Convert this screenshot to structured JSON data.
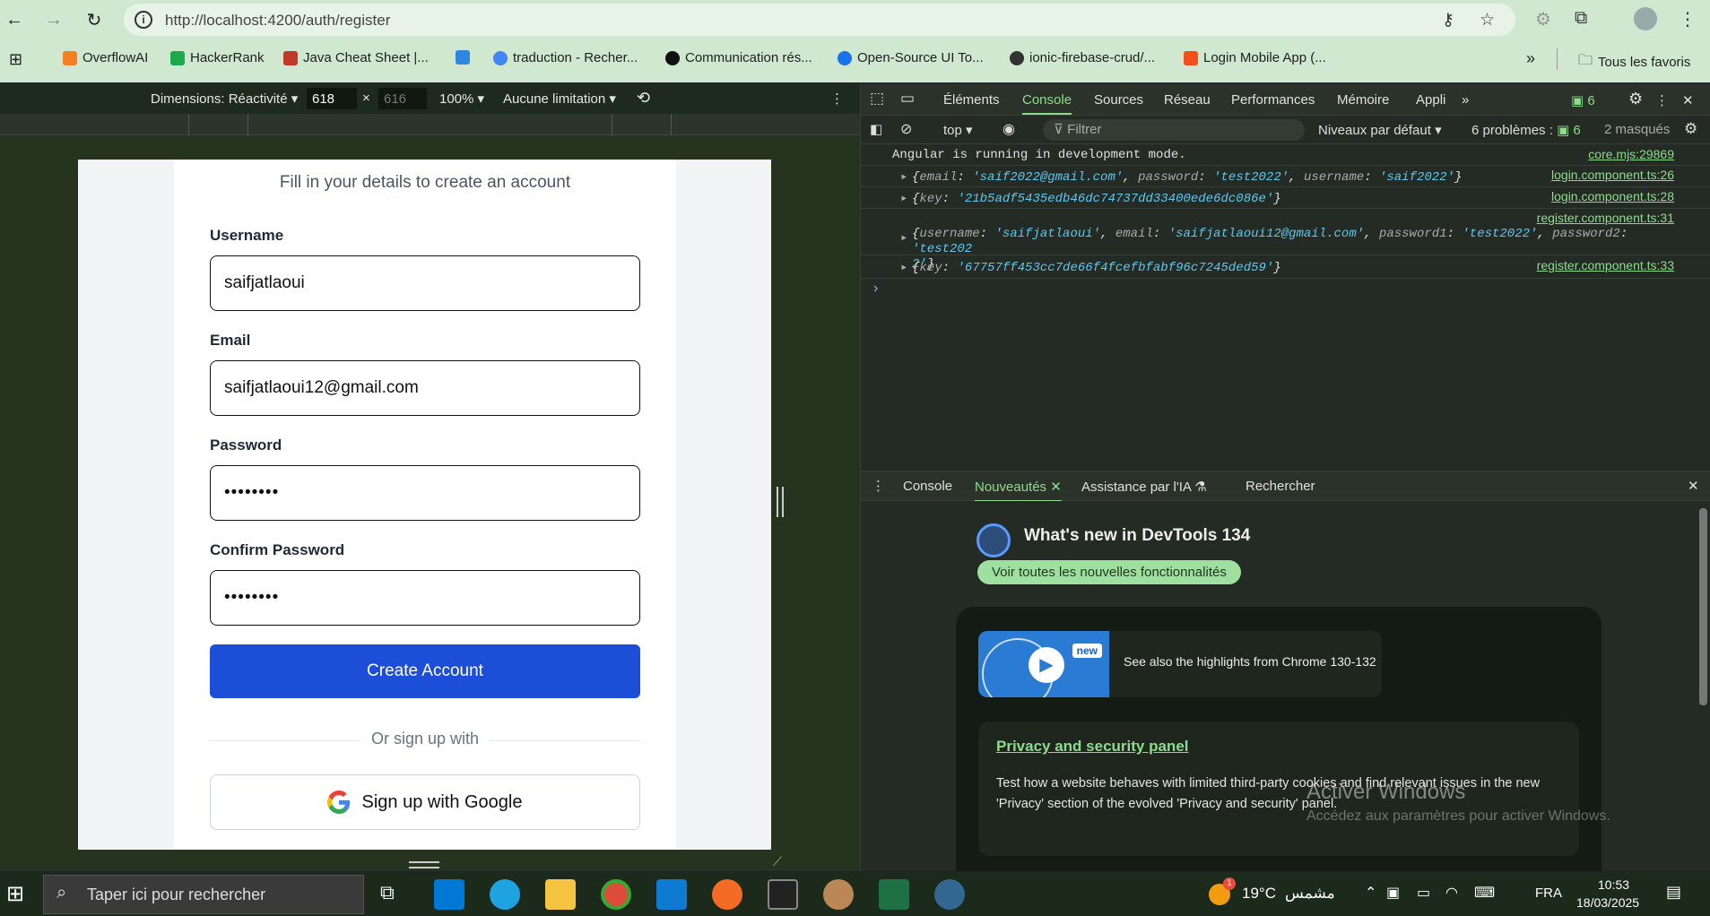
{
  "browser": {
    "url": "http://localhost:4200/auth/register",
    "bookmarks": [
      {
        "label": "OverflowAI",
        "color": "#f48024"
      },
      {
        "label": "HackerRank",
        "color": "#1ba94c"
      },
      {
        "label": "Java Cheat Sheet |...",
        "color": "#c0392b"
      },
      {
        "label": "",
        "color": "#2e86de"
      },
      {
        "label": "traduction - Recher...",
        "color": "#4285f4"
      },
      {
        "label": "Communication rés...",
        "color": "#111111"
      },
      {
        "label": "Open-Source UI To...",
        "color": "#1a73e8"
      },
      {
        "label": "ionic-firebase-crud/...",
        "color": "#333333"
      },
      {
        "label": "Login Mobile App (...",
        "color": "#f24e1e"
      }
    ],
    "more_bookmarks": "»",
    "all_favorites": "Tous les favoris"
  },
  "device_toolbar": {
    "dimensions_label": "Dimensions: Réactivité ▾",
    "width": "618",
    "height": "616",
    "zoom": "100% ▾",
    "throttle": "Aucune limitation ▾",
    "more": "⋮"
  },
  "form": {
    "subtitle": "Fill in your details to create an account",
    "username_label": "Username",
    "username_value": "saifjatlaoui",
    "email_label": "Email",
    "email_value": "saifjatlaoui12@gmail.com",
    "password_label": "Password",
    "password_value": "••••••••",
    "confirm_label": "Confirm Password",
    "confirm_value": "••••••••",
    "create_button": "Create Account",
    "divider": "Or sign up with",
    "google_button": "Sign up with Google"
  },
  "devtools": {
    "tabs": [
      "Éléments",
      "Console",
      "Sources",
      "Réseau",
      "Performances",
      "Mémoire",
      "Appli"
    ],
    "active_tab": "Console",
    "issues_count": "6",
    "context": "top ▾",
    "filter_placeholder": "Filtrer",
    "levels": "Niveaux par défaut ▾",
    "problems": "6 problèmes :",
    "problems_count": "6",
    "hidden": "2 masqués",
    "logs": [
      {
        "text": "Angular is running in development mode.",
        "source": "core.mjs:29869"
      },
      {
        "source": "login.component.ts:26"
      },
      {
        "source": "login.component.ts:28"
      },
      {
        "source": "register.component.ts:31"
      },
      {
        "source": "register.component.ts:33"
      }
    ],
    "log1": {
      "email_key": "email",
      "email_val": "'saif2022@gmail.com'",
      "password_key": "password",
      "password_val": "'test2022'",
      "username_key": "username",
      "username_val": "'saif2022'"
    },
    "log2": {
      "key": "key",
      "val": "'21b5adf5435edb46dc74737dd33400ede6dc086e'"
    },
    "log3": {
      "username_key": "username",
      "username_val": "'saifjatlaoui'",
      "email_key": "email",
      "email_val": "'saifjatlaoui12@gmail.com'",
      "p1_key": "password1",
      "p1_val": "'test2022'",
      "p2_key": "password2",
      "p2_val_a": "'test202",
      "p2_val_b": "2'"
    },
    "log4": {
      "key": "key",
      "val": "'67757ff453cc7de66f4fcefbfabf96c7245ded59'"
    },
    "drawer_tabs": [
      "Console",
      "Nouveautés",
      "Assistance par l'IA",
      "Rechercher"
    ],
    "whats_new_title": "What's new in DevTools 134",
    "see_all_button": "Voir toutes les nouvelles fonctionnalités",
    "video_badge": "new",
    "video_text": "See also the highlights from Chrome 130-132",
    "privacy_title": "Privacy and security panel",
    "privacy_text": "Test how a website behaves with limited third-party cookies and find relevant issues in the new 'Privacy' section of the evolved 'Privacy and security' panel."
  },
  "watermark": {
    "title": "Activer Windows",
    "subtitle": "Accédez aux paramètres pour activer Windows."
  },
  "taskbar": {
    "search_placeholder": "Taper ici pour rechercher",
    "weather_temp": "19°C",
    "weather_text": "مشمس",
    "weather_badge": "1",
    "language": "FRA",
    "time": "10:53",
    "date": "18/03/2025"
  }
}
